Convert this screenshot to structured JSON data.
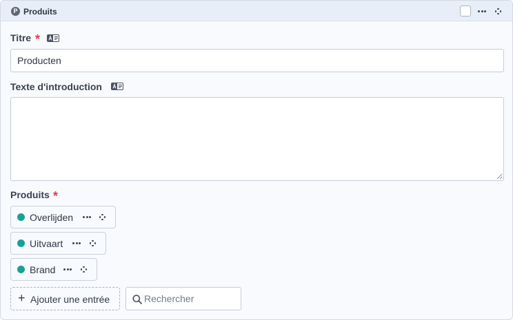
{
  "block": {
    "badge_letter": "P",
    "title": "Produits"
  },
  "fields": {
    "title": {
      "label": "Titre",
      "required_mark": "*",
      "value": "Producten"
    },
    "intro": {
      "label": "Texte d'introduction",
      "value": ""
    },
    "products": {
      "label": "Produits",
      "required_mark": "*",
      "items": [
        {
          "label": "Overlijden",
          "status_color": "#16a394"
        },
        {
          "label": "Uitvaart",
          "status_color": "#16a394"
        },
        {
          "label": "Brand",
          "status_color": "#16a394"
        }
      ],
      "add_icon": "+",
      "add_label": "Ajouter une entrée",
      "search_placeholder": "Rechercher"
    }
  },
  "icons": {
    "badge": "letter-p-icon",
    "more": "more-horizontal-icon",
    "move": "drag-move-icon",
    "translate": "translate-icon",
    "search": "search-icon",
    "add": "plus-icon"
  },
  "colors": {
    "required": "#e23b57",
    "status_published": "#16a394",
    "header_bg": "#e7eef7"
  }
}
